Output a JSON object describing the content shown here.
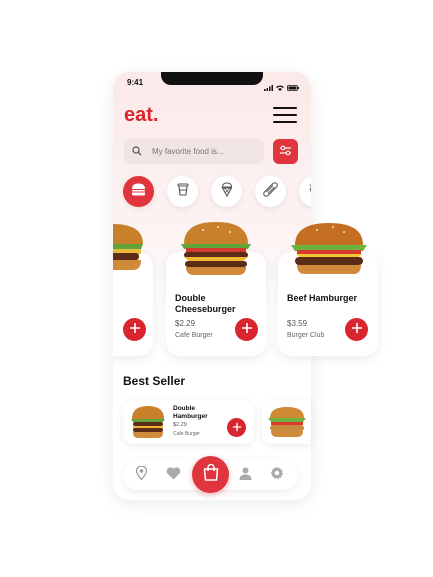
{
  "status_bar": {
    "time": "9:41"
  },
  "header": {
    "logo": "eat.",
    "menu_icon": "hamburger-menu-icon"
  },
  "search": {
    "placeholder": "My favorite food is...",
    "icon": "search-icon",
    "filter_icon": "sliders-icon"
  },
  "categories": [
    {
      "icon": "burger-icon",
      "active": true
    },
    {
      "icon": "drink-cup-icon",
      "active": false
    },
    {
      "icon": "ice-cream-icon",
      "active": false
    },
    {
      "icon": "hotdog-icon",
      "active": false
    },
    {
      "icon": "candy-icon",
      "active": false
    }
  ],
  "products": [
    {
      "name": "Double Cheeseburger",
      "price": "$2.29",
      "shop": "Cafe Burger"
    },
    {
      "name": "Beef Hamburger",
      "price": "$3.59",
      "shop": "Burger Club"
    }
  ],
  "best_seller": {
    "title": "Best Seller",
    "items": [
      {
        "name": "Double Hamburger",
        "price": "$2.29",
        "shop": "Cafe Burger"
      }
    ]
  },
  "bottom_nav": [
    "location-pin-icon",
    "heart-icon",
    "shopping-bag-icon",
    "user-icon",
    "settings-icon"
  ],
  "colors": {
    "accent": "#e0353c",
    "brand": "#d9252f",
    "background": "#fdf1f1"
  }
}
